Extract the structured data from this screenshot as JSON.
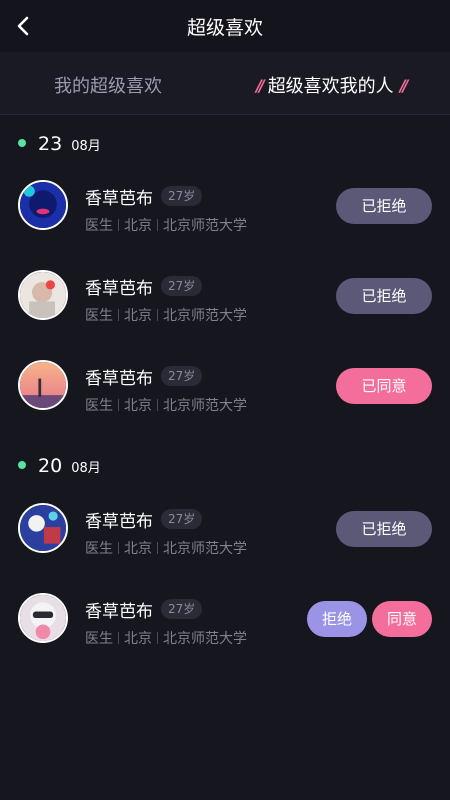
{
  "header": {
    "title": "超级喜欢",
    "back_icon": "chevron-left-icon"
  },
  "tabs": [
    {
      "label": "我的超级喜欢",
      "active": false
    },
    {
      "label": "超级喜欢我的人",
      "active": true,
      "decoration": "//"
    }
  ],
  "groups": [
    {
      "day": "23",
      "month": "08月"
    },
    {
      "day": "20",
      "month": "08月"
    }
  ],
  "people": [
    {
      "name": "香草芭布",
      "age": "27岁",
      "job": "医生",
      "city": "北京",
      "school": "北京师范大学",
      "status": "已拒绝"
    },
    {
      "name": "香草芭布",
      "age": "27岁",
      "job": "医生",
      "city": "北京",
      "school": "北京师范大学",
      "status": "已拒绝"
    },
    {
      "name": "香草芭布",
      "age": "27岁",
      "job": "医生",
      "city": "北京",
      "school": "北京师范大学",
      "status": "已同意"
    },
    {
      "name": "香草芭布",
      "age": "27岁",
      "job": "医生",
      "city": "北京",
      "school": "北京师范大学",
      "status": "已拒绝"
    },
    {
      "name": "香草芭布",
      "age": "27岁",
      "job": "医生",
      "city": "北京",
      "school": "北京师范大学",
      "reject_label": "拒绝",
      "agree_label": "同意"
    }
  ],
  "colors": {
    "accent_pink": "#f36e9a",
    "muted_purple": "#5b5878",
    "reject_purple": "#9a93e6",
    "dot_green": "#57e3a0"
  }
}
